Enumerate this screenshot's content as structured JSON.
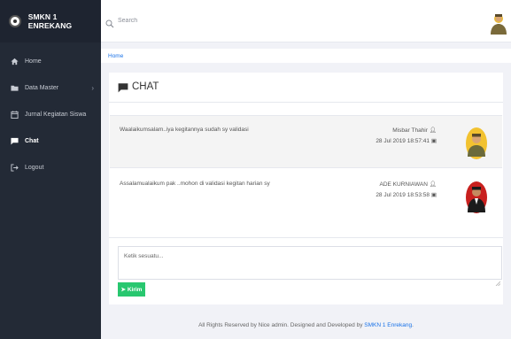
{
  "brand": {
    "name": "SMKN 1 ENREKANG",
    "logo_icon": "school-emblem-icon"
  },
  "sidebar": {
    "items": [
      {
        "label": "Home",
        "icon": "home-icon"
      },
      {
        "label": "Data Master",
        "icon": "folder-icon",
        "has_submenu": true
      },
      {
        "label": "Jurnal Kegiatan Siswa",
        "icon": "calendar-icon"
      },
      {
        "label": "Chat",
        "icon": "chat-icon",
        "active": true
      },
      {
        "label": "Logout",
        "icon": "logout-icon"
      }
    ]
  },
  "search": {
    "placeholder": "Search"
  },
  "breadcrumb": {
    "home": "Home"
  },
  "chat": {
    "title": "CHAT",
    "messages": [
      {
        "text": "Waalaikumsalam..iya kegitannya sudah sy validasi",
        "sender": "Misbar Thahir",
        "time": "28 Jul 2019 18:57:41"
      },
      {
        "text": "Assalamualaikum pak ..mohon di validasi kegitan harian sy",
        "sender": "ADE KURNIAWAN",
        "time": "28 Jul 2019 18:53:58"
      }
    ],
    "input_placeholder": "Ketik sesuatu...",
    "send_label": "Kirim"
  },
  "footer": {
    "text": "All Rights Reserved by Nice admin. Designed and Developed by ",
    "link": "SMKN 1 Enrekang",
    "end": "."
  },
  "colors": {
    "sidebar": "#232a36",
    "accent": "#1a73e8",
    "send_button": "#28c76f",
    "page_bg": "#f1f2f7"
  }
}
